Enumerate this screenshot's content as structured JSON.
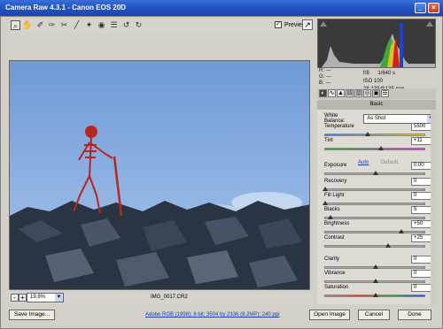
{
  "window": {
    "title": "Camera Raw 4.3.1  -  Canon EOS 20D"
  },
  "toolbar": {
    "preview_label": "Preview",
    "preview_checked": "✓"
  },
  "preview_footer": {
    "zoom": "19.9%",
    "filename": "IMG_0017.CR2"
  },
  "readout": {
    "r": "R:  ---",
    "g": "G:  ---",
    "b": "B:  ---",
    "aperture": "f/8",
    "shutter": "1/640 s",
    "iso": "ISO 100",
    "lens": "28-135@135 mm"
  },
  "panel": {
    "title": "Basic",
    "white_balance_label": "White Balance:",
    "white_balance_value": "As Shot",
    "auto_label": "Auto",
    "default_label": "Default",
    "sliders": [
      {
        "label": "Temperature",
        "value": "5500",
        "position": 0.42
      },
      {
        "label": "Tint",
        "value": "+11",
        "position": 0.55
      },
      {
        "label": "Exposure",
        "value": "0.00",
        "position": 0.5
      },
      {
        "label": "Recovery",
        "value": "0",
        "position": 0.0
      },
      {
        "label": "Fill Light",
        "value": "0",
        "position": 0.0
      },
      {
        "label": "Blacks",
        "value": "5",
        "position": 0.05
      },
      {
        "label": "Brightness",
        "value": "+50",
        "position": 0.75
      },
      {
        "label": "Contrast",
        "value": "+25",
        "position": 0.62
      },
      {
        "label": "Clarity",
        "value": "0",
        "position": 0.5
      },
      {
        "label": "Vibrance",
        "value": "0",
        "position": 0.5
      },
      {
        "label": "Saturation",
        "value": "0",
        "position": 0.5
      }
    ]
  },
  "buttons": {
    "save": "Save Image...",
    "open": "Open Image",
    "cancel": "Cancel",
    "done": "Done"
  },
  "workflow_link": "Adobe RGB (1998); 8 bit; 3504 by 2336 (8.2MP); 240 ppi",
  "icons": {
    "zoom": "zoom-icon",
    "hand": "hand-icon",
    "rotate": "rotate-icon"
  },
  "colors": {
    "titlebar": "#2456c8",
    "sky": "#8fb8e8",
    "rock": "#2a3442",
    "skeleton": "#b8261e"
  }
}
